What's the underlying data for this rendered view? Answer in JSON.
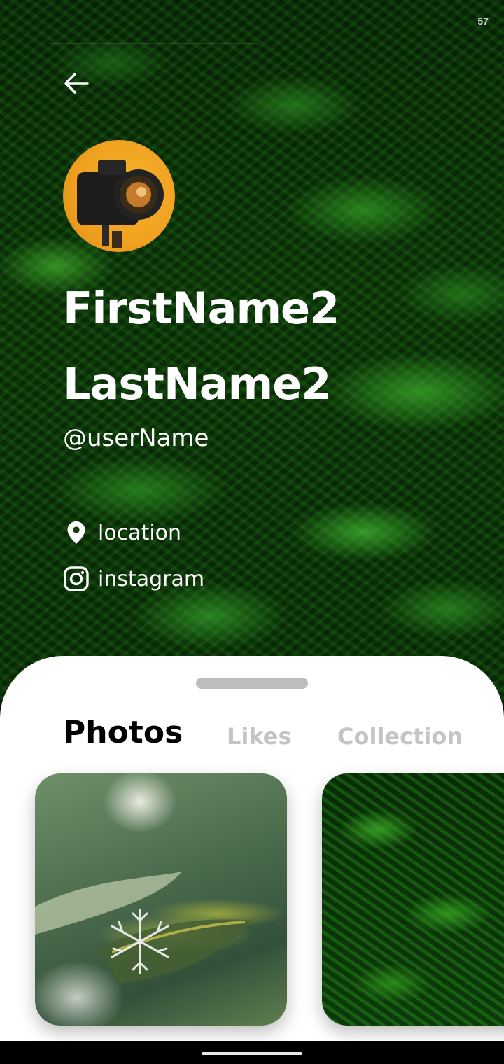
{
  "status_bar": {
    "time": "57"
  },
  "profile": {
    "first_name": "FirstName2",
    "last_name": "LastName2",
    "username": "@userName",
    "location": "location",
    "instagram": "instagram",
    "avatar_icon": "camera-photo"
  },
  "tabs": [
    {
      "label": "Photos",
      "active": true
    },
    {
      "label": "Likes",
      "active": false
    },
    {
      "label": "Collection",
      "active": false
    }
  ],
  "photos": [
    {
      "subject": "snowflake on leaf"
    },
    {
      "subject": "fern leaves"
    }
  ],
  "colors": {
    "active_tab": "#000000",
    "inactive_tab": "#c4c4c4",
    "sheet": "#ffffff"
  }
}
